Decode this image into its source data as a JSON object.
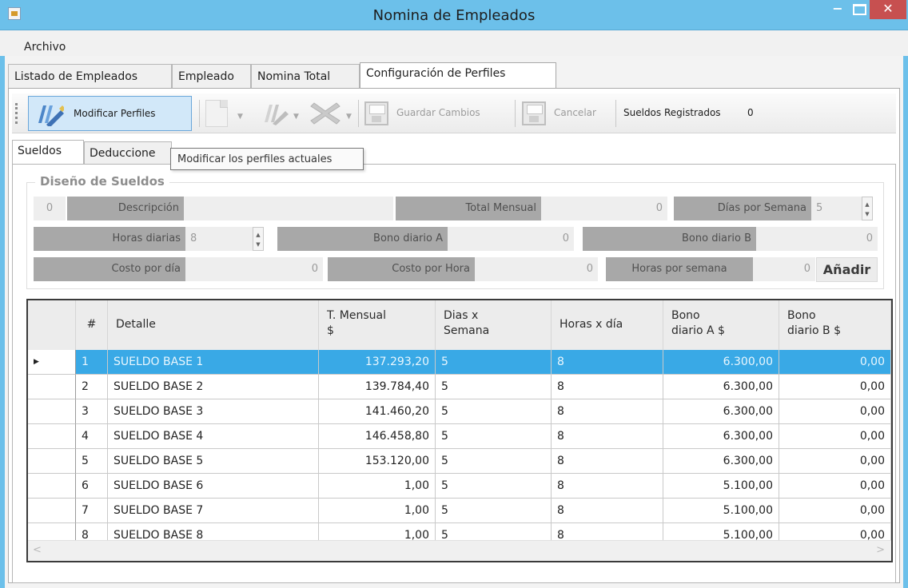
{
  "window": {
    "title": "Nomina de Empleados"
  },
  "menu": {
    "archivo": "Archivo"
  },
  "tabs": [
    {
      "label": "Listado de Empleados"
    },
    {
      "label": "Empleado"
    },
    {
      "label": "Nomina Total"
    },
    {
      "label": "Configuración de Perfiles"
    }
  ],
  "toolbar": {
    "modificar": "Modificar Perfiles",
    "guardar": "Guardar Cambios",
    "cancelar": "Cancelar",
    "sueldos_registrados_label": "Sueldos Registrados",
    "sueldos_registrados_value": "0"
  },
  "inner_tabs": [
    {
      "label": "Sueldos"
    },
    {
      "label": "Deduccione"
    }
  ],
  "tooltip": "Modificar los perfiles actuales",
  "group": {
    "title": "Diseño de Sueldos"
  },
  "fields": {
    "id_value": "0",
    "descripcion_label": "Descripción",
    "descripcion_value": "",
    "total_mensual_label": "Total Mensual",
    "total_mensual_value": "0",
    "dias_semana_label": "Días por Semana",
    "dias_semana_value": "5",
    "horas_diarias_label": "Horas diarias",
    "horas_diarias_value": "8",
    "bono_a_label": "Bono diario A",
    "bono_a_value": "0",
    "bono_b_label": "Bono diario B",
    "bono_b_value": "0",
    "costo_dia_label": "Costo por día",
    "costo_dia_value": "0",
    "costo_hora_label": "Costo por Hora",
    "costo_hora_value": "0",
    "horas_semana_label": "Horas por semana",
    "horas_semana_value": "0",
    "anadir": "Añadir"
  },
  "grid": {
    "columns": {
      "num": "#",
      "detalle": "Detalle",
      "mensual_1": "T. Mensual",
      "mensual_2": "$",
      "dias_1": "Dias x",
      "dias_2": "Semana",
      "horas": "Horas x día",
      "bono_a_1": "Bono",
      "bono_a_2": "diario A $",
      "bono_b_1": "Bono",
      "bono_b_2": "diario B $"
    },
    "rows": [
      {
        "num": "1",
        "detalle": "SUELDO BASE 1",
        "mensual": "137.293,20",
        "dias": "5",
        "horas": "8",
        "bono_a": "6.300,00",
        "bono_b": "0,00"
      },
      {
        "num": "2",
        "detalle": "SUELDO BASE 2",
        "mensual": "139.784,40",
        "dias": "5",
        "horas": "8",
        "bono_a": "6.300,00",
        "bono_b": "0,00"
      },
      {
        "num": "3",
        "detalle": "SUELDO BASE 3",
        "mensual": "141.460,20",
        "dias": "5",
        "horas": "8",
        "bono_a": "6.300,00",
        "bono_b": "0,00"
      },
      {
        "num": "4",
        "detalle": "SUELDO BASE 4",
        "mensual": "146.458,80",
        "dias": "5",
        "horas": "8",
        "bono_a": "6.300,00",
        "bono_b": "0,00"
      },
      {
        "num": "5",
        "detalle": "SUELDO BASE 5",
        "mensual": "153.120,00",
        "dias": "5",
        "horas": "8",
        "bono_a": "6.300,00",
        "bono_b": "0,00"
      },
      {
        "num": "6",
        "detalle": "SUELDO BASE 6",
        "mensual": "1,00",
        "dias": "5",
        "horas": "8",
        "bono_a": "5.100,00",
        "bono_b": "0,00"
      },
      {
        "num": "7",
        "detalle": "SUELDO BASE 7",
        "mensual": "1,00",
        "dias": "5",
        "horas": "8",
        "bono_a": "5.100,00",
        "bono_b": "0,00"
      },
      {
        "num": "8",
        "detalle": "SUELDO BASE 8",
        "mensual": "1,00",
        "dias": "5",
        "horas": "8",
        "bono_a": "5.100,00",
        "bono_b": "0,00"
      }
    ]
  },
  "colors": {
    "titlebar": "#6cc0ea",
    "selection": "#39a9e6",
    "close_button": "#c75050"
  }
}
